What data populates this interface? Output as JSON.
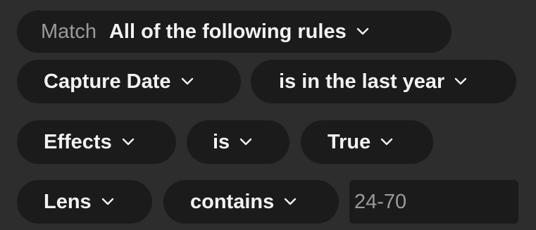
{
  "match_row": {
    "prefix": "Match",
    "value": "All of the following rules"
  },
  "rules": [
    {
      "field": "Capture Date",
      "operator": "is in the last year"
    },
    {
      "field": "Effects",
      "operator": "is",
      "value": "True"
    },
    {
      "field": "Lens",
      "operator": "contains",
      "value": "24-70"
    }
  ],
  "icons": {
    "dropdown": "chevron-down-icon"
  },
  "colors": {
    "background": "#2d2d2d",
    "pill": "#1b1b1b",
    "text": "#f2f2f2",
    "muted_text": "#9a9a9a"
  }
}
